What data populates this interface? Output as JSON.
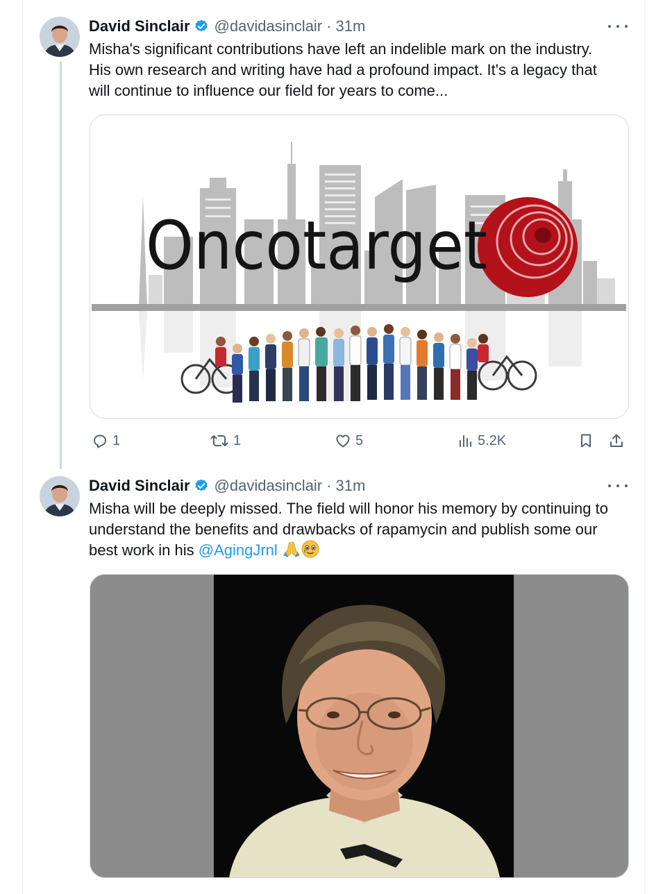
{
  "tweets": [
    {
      "author": "David Sinclair",
      "handle": "@davidasinclair",
      "separator": "·",
      "time": "31m",
      "text_lines": [
        "Misha's significant contributions have left an indelible mark on the industry.",
        "His own research and writing have had a profound impact. It's a legacy that",
        "will continue to influence our field for years to come..."
      ],
      "media": {
        "logo_text": "Oncotarget"
      },
      "stats": {
        "replies": "1",
        "reposts": "1",
        "likes": "5",
        "views": "5.2K"
      }
    },
    {
      "author": "David Sinclair",
      "handle": "@davidasinclair",
      "separator": "·",
      "time": "31m",
      "text_lines": [
        "Misha will be deeply missed. The field will honor his memory by continuing to",
        "understand the benefits and drawbacks of rapamycin and publish some our"
      ],
      "text_line3_prefix": "best work in his ",
      "mention": "@AgingJrnl",
      "emojis": [
        "folded-hands",
        "teary-smile"
      ]
    }
  ],
  "icons": [
    "verified-badge-icon",
    "more-icon",
    "reply-icon",
    "repost-icon",
    "like-icon",
    "views-icon",
    "bookmark-icon",
    "share-icon"
  ],
  "colors": {
    "accent": "#1d9bf0",
    "secondary_text": "#536471",
    "border": "#cfd9de",
    "logo_red": "#b3121a"
  }
}
